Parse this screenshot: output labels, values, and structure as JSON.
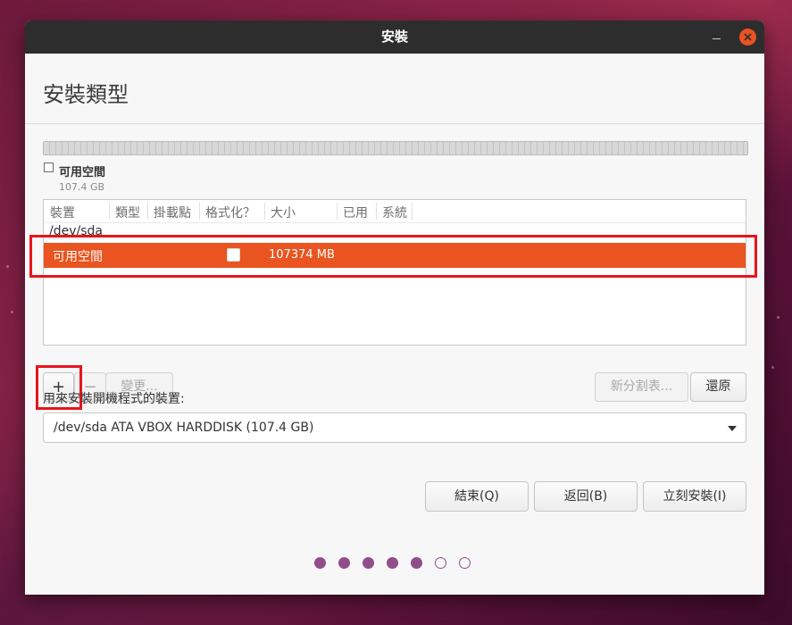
{
  "window": {
    "title": "安裝",
    "heading": "安裝類型"
  },
  "disk_legend": {
    "label": "可用空間",
    "size": "107.4 GB"
  },
  "partition_table": {
    "columns": [
      "裝置",
      "類型",
      "掛載點",
      "格式化？",
      "大小",
      "已用",
      "系統"
    ],
    "device": "/dev/sda",
    "rows": [
      {
        "device": "可用空間",
        "type": "",
        "mount": "",
        "format": false,
        "size": "107374 MB",
        "used": "",
        "system": "",
        "selected": true
      }
    ]
  },
  "partition_buttons": {
    "add": "+",
    "remove": "−",
    "change": "變更...",
    "new_table": "新分割表...",
    "revert": "還原"
  },
  "bootloader": {
    "label": "用來安裝開機程式的裝置:",
    "selected": "/dev/sda ATA VBOX HARDDISK (107.4 GB)"
  },
  "actions": {
    "quit": "結束(Q)",
    "back": "返回(B)",
    "install": "立刻安裝(I)"
  },
  "progress": {
    "total_steps": 7,
    "completed_steps": 5
  },
  "colors": {
    "accent": "#e95420",
    "highlight_box": "#e8141c",
    "progress_dot": "#924d8b",
    "titlebar": "#2d2d2d"
  }
}
